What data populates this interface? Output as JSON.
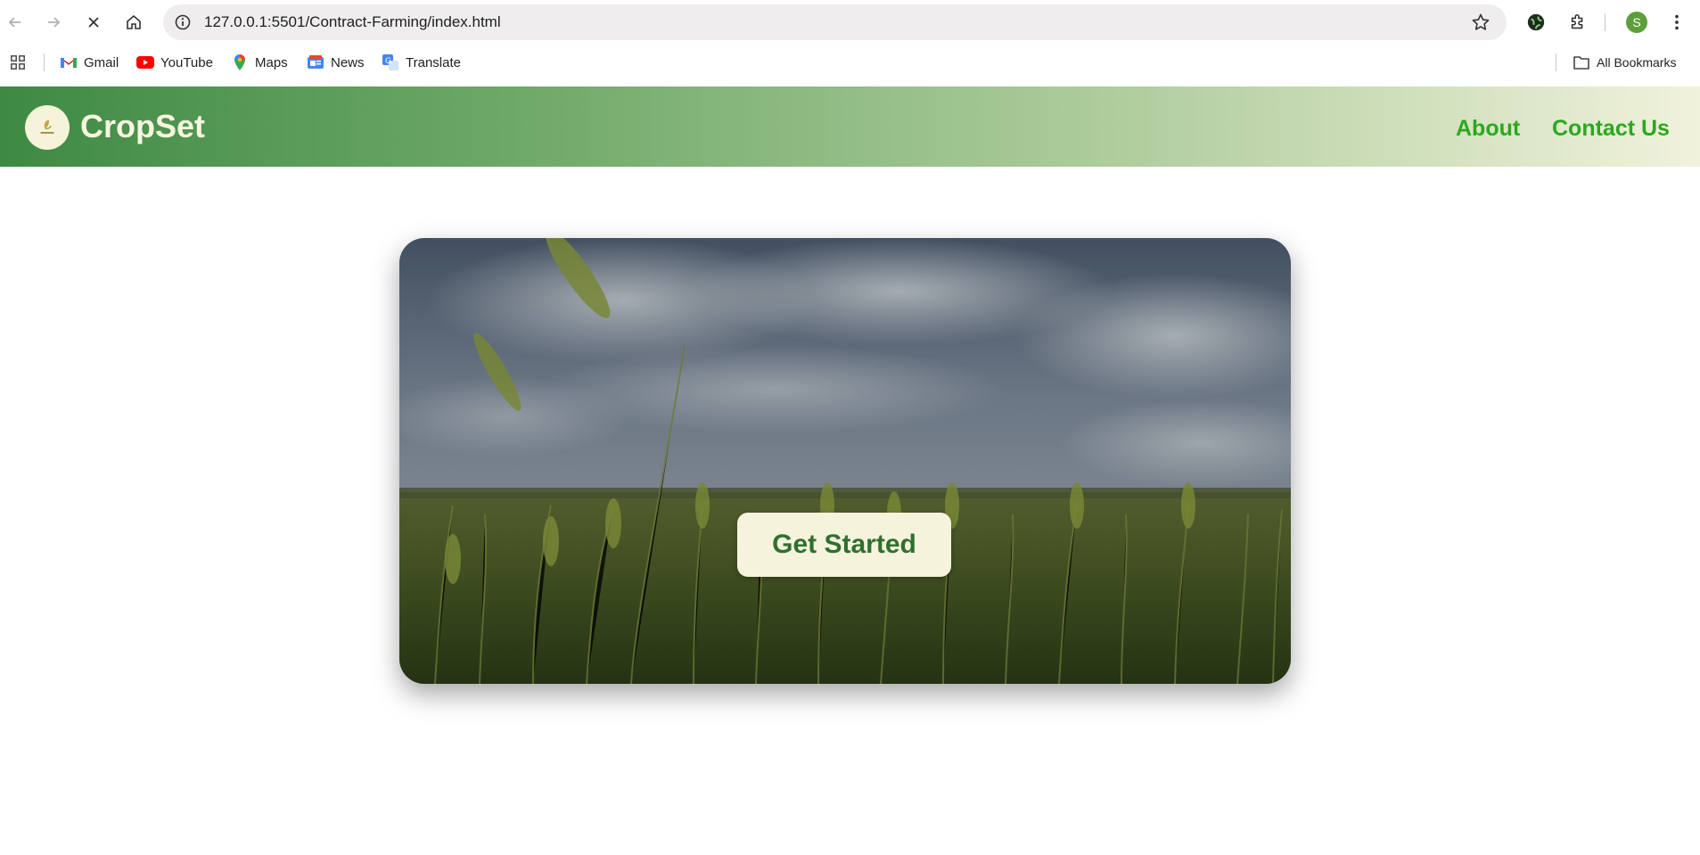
{
  "browser": {
    "url": "127.0.0.1:5501/Contract-Farming/index.html",
    "profile_initial": "S",
    "icons": [
      "back-icon",
      "forward-icon",
      "stop-icon",
      "home-icon",
      "site-info-icon",
      "star-icon",
      "extension-globe-icon",
      "puzzle-icon",
      "menu-dots-icon"
    ]
  },
  "bookmarks": {
    "items": [
      {
        "label": "Gmail",
        "icon": "gmail-icon"
      },
      {
        "label": "YouTube",
        "icon": "youtube-icon"
      },
      {
        "label": "Maps",
        "icon": "maps-icon"
      },
      {
        "label": "News",
        "icon": "news-icon"
      },
      {
        "label": "Translate",
        "icon": "translate-icon"
      }
    ],
    "all_label": "All Bookmarks"
  },
  "site": {
    "brand": "CropSet",
    "nav": [
      {
        "label": "About"
      },
      {
        "label": "Contact Us"
      }
    ],
    "hero": {
      "cta_label": "Get Started"
    },
    "colors": {
      "header_start": "#3e8a43",
      "header_end": "#f1f2dc",
      "nav_link": "#2ba81f",
      "cta_bg": "#f5f3dc",
      "cta_text": "#2f6f2f"
    }
  }
}
